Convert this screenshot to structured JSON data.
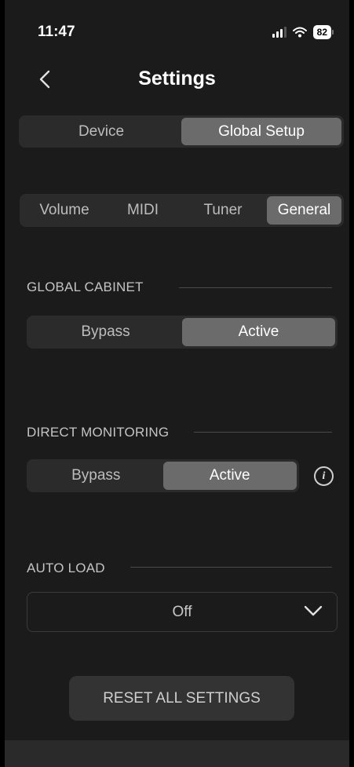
{
  "status_bar": {
    "time": "11:47",
    "battery": "82"
  },
  "header": {
    "title": "Settings"
  },
  "top_segment": {
    "options": [
      "Device",
      "Global Setup"
    ],
    "selected": "Global Setup"
  },
  "tabs": {
    "items": [
      "Volume",
      "MIDI",
      "Tuner",
      "General"
    ],
    "selected": "General"
  },
  "global_cabinet": {
    "label": "GLOBAL CABINET",
    "options": [
      "Bypass",
      "Active"
    ],
    "selected": "Active"
  },
  "direct_monitoring": {
    "label": "DIRECT MONITORING",
    "options": [
      "Bypass",
      "Active"
    ],
    "selected": "Active",
    "info_icon": "i"
  },
  "auto_load": {
    "label": "AUTO LOAD",
    "value": "Off"
  },
  "reset_button": {
    "label": "RESET ALL SETTINGS"
  },
  "colors": {
    "background": "#1b1b1b",
    "segment_bg": "#2b2b2b",
    "segment_selected": "#6b6b6b"
  }
}
